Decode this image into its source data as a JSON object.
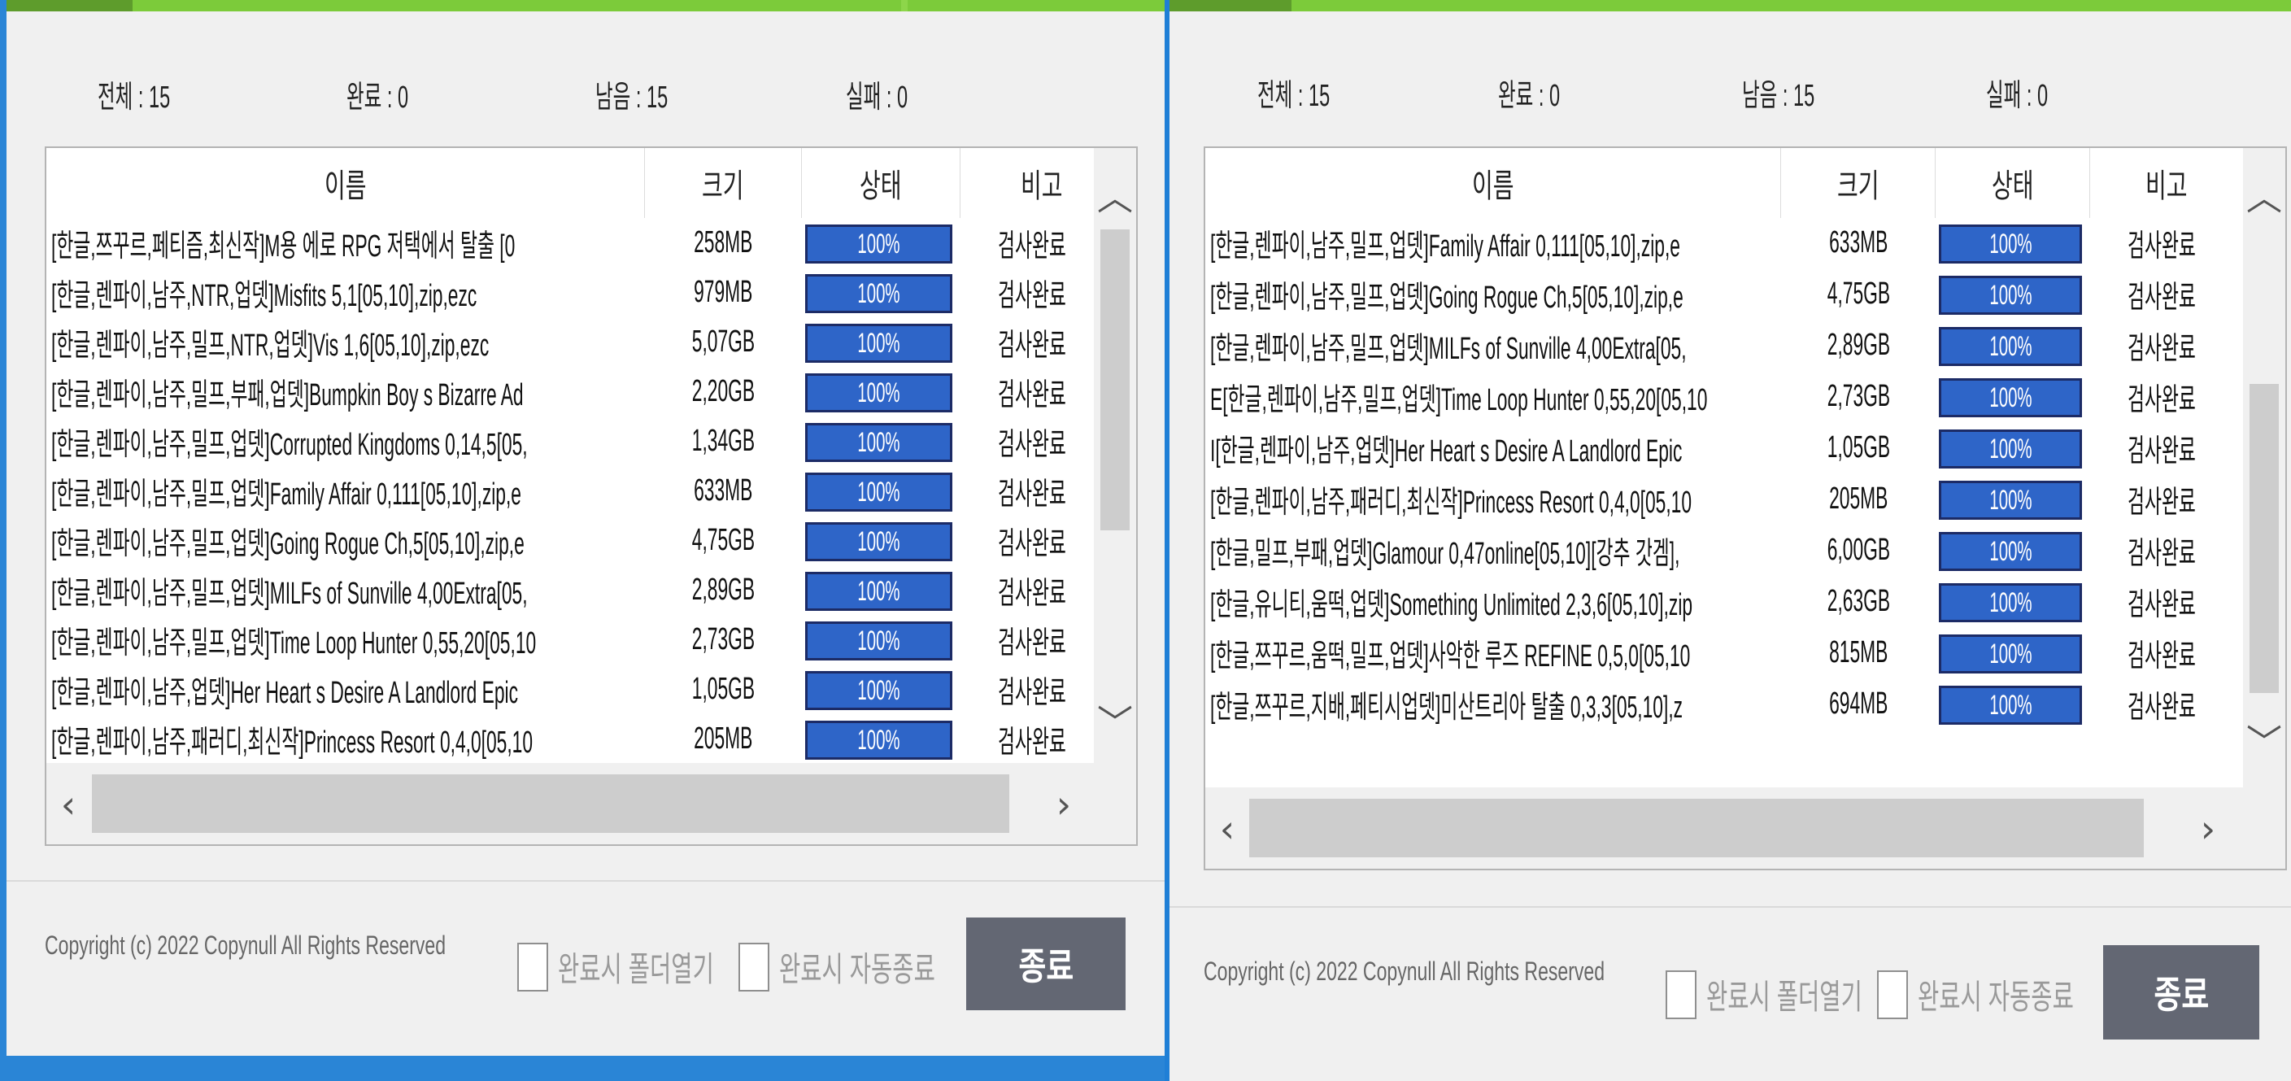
{
  "colors": {
    "accent_green": "#7ccb3a",
    "progress_blue": "#2e65c8",
    "button_gray": "#636773"
  },
  "stats": {
    "total": "전체 : 15",
    "done": "완료 : 0",
    "remaining": "남음 : 15",
    "failed": "실패 : 0"
  },
  "columns": {
    "name": "이름",
    "size": "크기",
    "status": "상태",
    "note": "비고"
  },
  "footer": {
    "copyright": "Copyright (c) 2022 Copynull All Rights Reserved",
    "open_folder": "완료시 폴더열기",
    "auto_exit": "완료시 자동종료",
    "exit_label": "종료"
  },
  "scroll_icons": {
    "up": "▲-chevron-up-icon",
    "down": "chevron-down-icon",
    "left": "chevron-left-icon",
    "right": "chevron-right-icon"
  },
  "left_panel": {
    "rows": [
      {
        "name": "[한글,쯔꾸르,페티즘,최신작]M용 에로 RPG 저택에서 탈출 [0",
        "size": "258MB",
        "status": "100%",
        "progress": 1.0,
        "note": "검사완료"
      },
      {
        "name": "[한글,렌파이,남주,NTR,업뎃]Misfits 5,1[05,10],zip,ezc",
        "size": "979MB",
        "status": "100%",
        "progress": 1.0,
        "note": "검사완료"
      },
      {
        "name": "[한글,렌파이,남주,밀프,NTR,업뎃]Vis 1,6[05,10],zip,ezc",
        "size": "5,07GB",
        "status": "100%",
        "progress": 1.0,
        "note": "검사완료"
      },
      {
        "name": "[한글,렌파이,남주,밀프,부패,업뎃]Bumpkin Boy s Bizarre Ad",
        "size": "2,20GB",
        "status": "100%",
        "progress": 1.0,
        "note": "검사완료"
      },
      {
        "name": "[한글,렌파이,남주,밀프,업뎃]Corrupted Kingdoms 0,14,5[05,",
        "size": "1,34GB",
        "status": "100%",
        "progress": 1.0,
        "note": "검사완료"
      },
      {
        "name": "[한글,렌파이,남주,밀프,업뎃]Family Affair 0,111[05,10],zip,e",
        "size": "633MB",
        "status": "100%",
        "progress": 1.0,
        "note": "검사완료"
      },
      {
        "name": "[한글,렌파이,남주,밀프,업뎃]Going Rogue Ch,5[05,10],zip,e",
        "size": "4,75GB",
        "status": "100%",
        "progress": 1.0,
        "note": "검사완료"
      },
      {
        "name": "[한글,렌파이,남주,밀프,업뎃]MILFs of Sunville 4,00Extra[05,",
        "size": "2,89GB",
        "status": "100%",
        "progress": 1.0,
        "note": "검사완료"
      },
      {
        "name": "[한글,렌파이,남주,밀프,업뎃]Time Loop Hunter 0,55,20[05,10",
        "size": "2,73GB",
        "status": "100%",
        "progress": 1.0,
        "note": "검사완료"
      },
      {
        "name": "[한글,렌파이,남주,업뎃]Her Heart s Desire A Landlord Epic",
        "size": "1,05GB",
        "status": "100%",
        "progress": 1.0,
        "note": "검사완료"
      },
      {
        "name": "[한글,렌파이,남주,패러디,최신작]Princess Resort 0,4,0[05,10",
        "size": "205MB",
        "status": "100%",
        "progress": 1.0,
        "note": "검사완료"
      }
    ]
  },
  "right_panel": {
    "rows": [
      {
        "name": "[한글,렌파이,남주,밀프,업뎃]Family Affair 0,111[05,10],zip,e",
        "size": "633MB",
        "status": "100%",
        "progress": 1.0,
        "note": "검사완료"
      },
      {
        "name": "[한글,렌파이,남주,밀프,업뎃]Going Rogue Ch,5[05,10],zip,e",
        "size": "4,75GB",
        "status": "100%",
        "progress": 1.0,
        "note": "검사완료"
      },
      {
        "name": "[한글,렌파이,남주,밀프,업뎃]MILFs of Sunville 4,00Extra[05,",
        "size": "2,89GB",
        "status": "100%",
        "progress": 1.0,
        "note": "검사완료"
      },
      {
        "name": "E[한글,렌파이,남주,밀프,업뎃]Time Loop Hunter 0,55,20[05,10",
        "size": "2,73GB",
        "status": "100%",
        "progress": 1.0,
        "note": "검사완료"
      },
      {
        "name": "I[한글,렌파이,남주,업뎃]Her Heart s Desire A Landlord Epic",
        "size": "1,05GB",
        "status": "100%",
        "progress": 1.0,
        "note": "검사완료"
      },
      {
        "name": "[한글,렌파이,남주,패러디,최신작]Princess Resort 0,4,0[05,10",
        "size": "205MB",
        "status": "100%",
        "progress": 1.0,
        "note": "검사완료"
      },
      {
        "name": "[한글,밀프,부패,업뎃]Glamour 0,47online[05,10][강추 갓겜],",
        "size": "6,00GB",
        "status": "100%",
        "progress": 1.0,
        "note": "검사완료"
      },
      {
        "name": "[한글,유니티,움떡,업뎃]Something Unlimited 2,3,6[05,10],zip",
        "size": "2,63GB",
        "status": "100%",
        "progress": 1.0,
        "note": "검사완료"
      },
      {
        "name": "[한글,쯔꾸르,움떡,밀프,업뎃]사악한 루즈 REFINE 0,5,0[05,10",
        "size": "815MB",
        "status": "100%",
        "progress": 1.0,
        "note": "검사완료"
      },
      {
        "name": "[한글,쯔꾸르,지배,페티시업뎃]미산트리아 탈출 0,3,3[05,10],z",
        "size": "694MB",
        "status": "100%",
        "progress": 1.0,
        "note": "검사완료"
      }
    ]
  }
}
